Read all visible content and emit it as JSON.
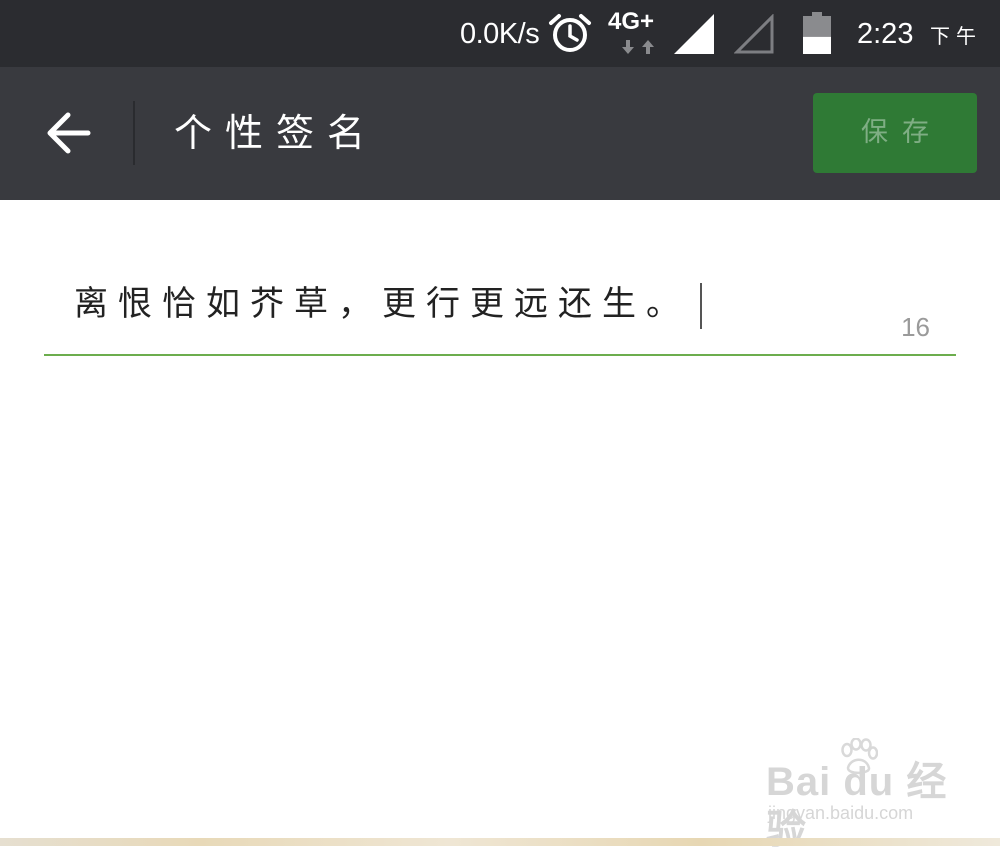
{
  "status_bar": {
    "net_speed": "0.0K/s",
    "network_type": "4G+",
    "clock": "2:23",
    "ampm": "下午",
    "icons": [
      "alarm-icon",
      "network-arrows-icon",
      "signal-full-icon",
      "signal-empty-icon",
      "battery-icon"
    ],
    "battery_level": 0.45
  },
  "title_bar": {
    "back_icon": "arrow-left-icon",
    "title": "个性签名",
    "save_label": "保存"
  },
  "signature": {
    "value": "离恨恰如芥草，更行更远还生。",
    "remaining_count": "16"
  },
  "watermark": {
    "brand": "Bai du 经验",
    "url": "jingyan.baidu.com",
    "icon": "paw-icon"
  },
  "colors": {
    "status_bar_bg": "#2b2c30",
    "title_bar_bg": "#393a3f",
    "save_button_bg": "#2f7a35",
    "save_button_text": "#7fae84",
    "input_underline": "#6cad4d",
    "counter_text": "#9a9a9a"
  }
}
